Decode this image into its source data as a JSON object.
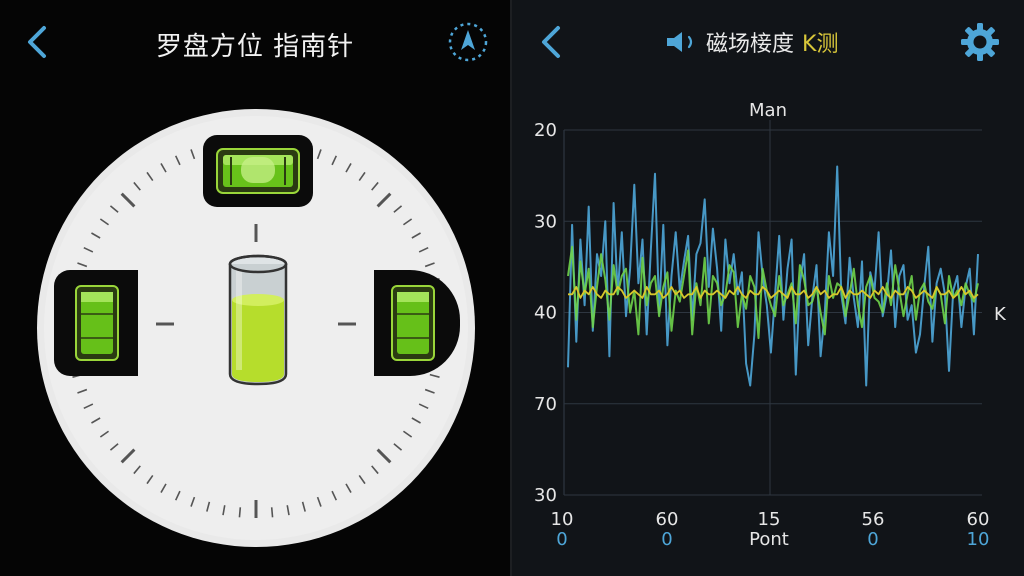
{
  "left_panel": {
    "title": "罗盘方位 指南针",
    "accent_color": "#4ea6d8",
    "level_color": "#7ed321",
    "icons": {
      "back": "chevron-left-icon",
      "nav": "navigation-compass-icon"
    }
  },
  "right_panel": {
    "title_main": "磁场椄度",
    "title_accent": "K测",
    "icons": {
      "back": "chevron-left-icon",
      "speaker": "speaker-icon",
      "settings": "gear-icon"
    },
    "colors": {
      "grid": "#2e3640",
      "blue": "#4ea6d8",
      "green": "#6fd34a",
      "yellow": "#d8c82b"
    }
  },
  "chart_data": {
    "type": "line",
    "title": "Man",
    "y_ticks": [
      "20",
      "30",
      "40",
      "70",
      "30"
    ],
    "right_label": "K",
    "x_ticks_top": [
      "10",
      "60",
      "15",
      "56",
      "60"
    ],
    "x_ticks_bottom": [
      "0",
      "0",
      "Pont",
      "0",
      "10"
    ],
    "series": [
      {
        "color": "blue",
        "values": [
          35,
          74,
          42,
          70,
          52,
          79,
          45,
          66,
          60,
          75,
          38,
          80,
          55,
          72,
          49,
          62,
          85,
          58,
          70,
          44,
          67,
          88,
          50,
          74,
          41,
          60,
          72,
          56,
          64,
          71,
          48,
          66,
          69,
          81,
          57,
          73,
          62,
          45,
          70,
          58,
          66,
          55,
          61,
          36,
          30,
          44,
          72,
          60,
          52,
          39,
          55,
          71,
          48,
          62,
          70,
          33,
          58,
          66,
          41,
          54,
          63,
          38,
          50,
          72,
          60,
          90,
          55,
          47,
          65,
          54,
          46,
          64,
          30,
          61,
          56,
          72,
          49,
          55,
          67,
          46,
          60,
          63,
          48,
          52,
          39,
          44,
          57,
          68,
          42,
          58,
          62,
          55,
          34,
          56,
          60,
          46,
          57,
          62,
          44,
          66
        ]
      },
      {
        "color": "green",
        "values": [
          60,
          68,
          48,
          64,
          55,
          62,
          46,
          57,
          66,
          59,
          48,
          63,
          55,
          60,
          62,
          50,
          56,
          44,
          65,
          52,
          58,
          60,
          49,
          57,
          61,
          45,
          56,
          53,
          60,
          67,
          44,
          58,
          52,
          65,
          47,
          60,
          58,
          52,
          55,
          63,
          61,
          46,
          55,
          51,
          60,
          57,
          43,
          62,
          56,
          52,
          49,
          60,
          52,
          55,
          58,
          47,
          63,
          59,
          52,
          53,
          57,
          50,
          44,
          60,
          54,
          58,
          57,
          49,
          55,
          62,
          52,
          46,
          57,
          60,
          54,
          53,
          50,
          58,
          52,
          63,
          56,
          49,
          55,
          60,
          48,
          56,
          58,
          53,
          51,
          57,
          55,
          47,
          60,
          54,
          56,
          52,
          58,
          55,
          53,
          58
        ]
      },
      {
        "color": "yellow",
        "values": [
          55,
          55,
          57,
          54,
          56,
          55,
          57,
          55,
          54,
          56,
          55,
          55,
          57,
          56,
          54,
          55,
          56,
          55,
          54,
          57,
          55,
          55,
          56,
          54,
          55,
          57,
          55,
          56,
          54,
          55,
          55,
          57,
          54,
          56,
          55,
          55,
          56,
          55,
          54,
          56,
          55,
          57,
          55,
          54,
          56,
          55,
          55,
          57,
          56,
          54,
          55,
          56,
          55,
          54,
          57,
          55,
          55,
          56,
          54,
          55,
          57,
          55,
          56,
          54,
          55,
          55,
          57,
          54,
          56,
          55,
          55,
          56,
          55,
          54,
          56,
          55,
          57,
          55,
          54,
          56,
          55,
          55,
          57,
          56,
          54,
          55,
          56,
          55,
          54,
          57,
          55,
          55,
          56,
          54,
          55,
          57,
          55,
          56,
          54,
          55
        ]
      }
    ],
    "grid": true
  }
}
